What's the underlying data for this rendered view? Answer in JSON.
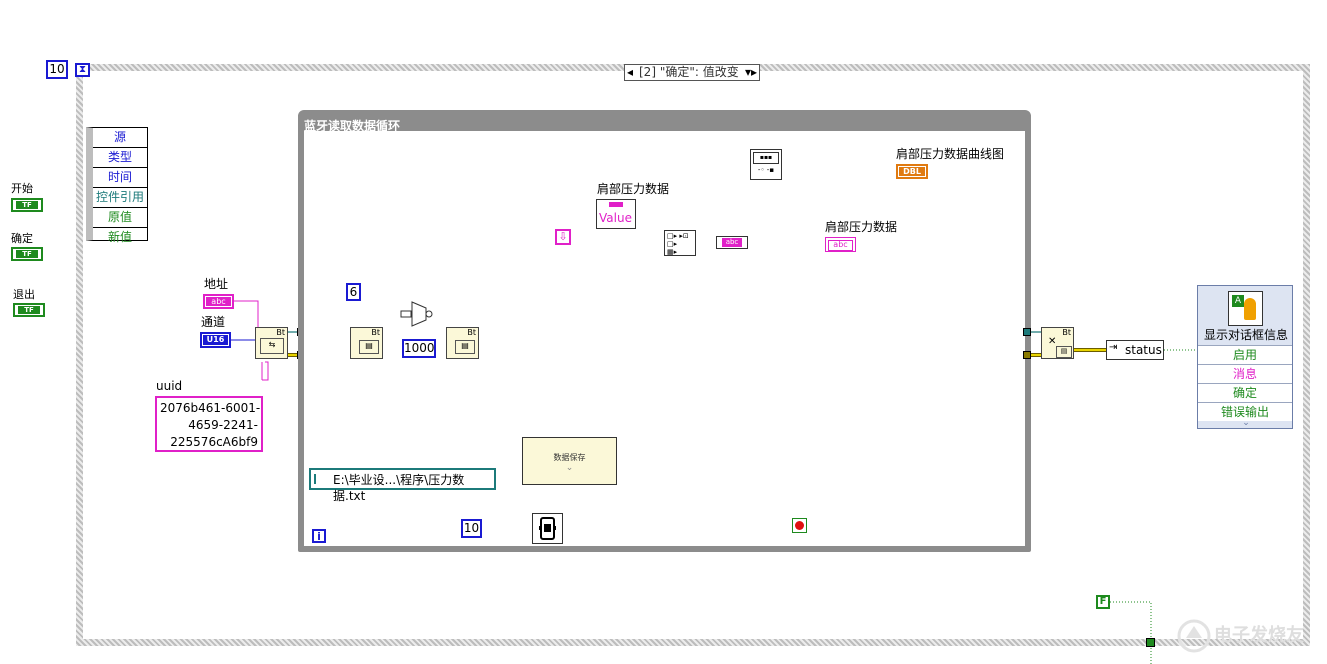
{
  "case_structure": {
    "selector_label": "[2] \"确定\": 值改变",
    "iteration_constant": "10"
  },
  "event_data_node": {
    "items": [
      "源",
      "类型",
      "时间",
      "控件引用",
      "原值",
      "新值"
    ]
  },
  "front_controls": [
    {
      "label": "开始",
      "type": "TF"
    },
    {
      "label": "确定",
      "type": "TF"
    },
    {
      "label": "退出",
      "type": "TF"
    }
  ],
  "inputs": {
    "address_label": "地址",
    "address_type": "abc",
    "channel_label": "通道",
    "channel_type": "U16",
    "uuid_label": "uuid",
    "uuid_value": "2076b461-6001-\n4659-2241-\n225576cA6bf9"
  },
  "while_loop": {
    "title": "蓝牙读取数据循环",
    "const_6": "6",
    "const_1000": "1000",
    "const_10": "10",
    "iteration_terminal": "i",
    "chart_label": "肩部压力数据曲线图",
    "chart_type": "DBL",
    "value_node_label": "肩部压力数据",
    "value_node_text": "Value",
    "indicator_label": "肩部压力数据",
    "indicator_type": "abc",
    "save_subvi_label": "数据保存",
    "file_path": "E:\\毕业设...\\程序\\压力数据.txt"
  },
  "outputs": {
    "status_label": "status",
    "false_constant": "F"
  },
  "dialog_node": {
    "title": "显示对话框信息",
    "items": [
      "启用",
      "消息",
      "确定",
      "错误输出"
    ]
  },
  "watermark": "电子发烧友",
  "colors": {
    "numeric_blue": "#1a1ad2",
    "boolean_green": "#1e8a1e",
    "string_pink": "#e020c8",
    "error_yellow": "#c8b400",
    "refnum_teal": "#1c7a7a",
    "dbl_orange": "#e07a10"
  }
}
